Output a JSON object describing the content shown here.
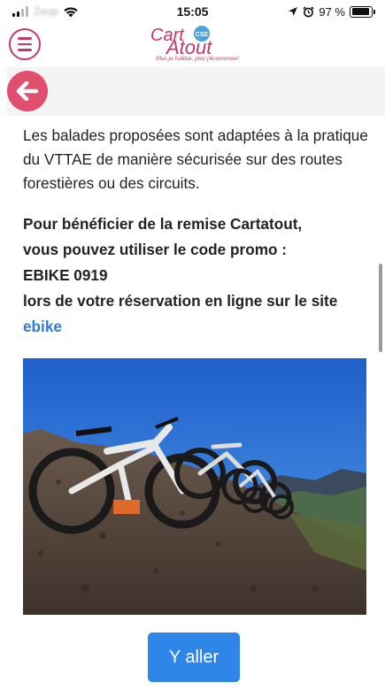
{
  "status_bar": {
    "carrier": "Zeop",
    "time": "15:05",
    "battery": "97 %",
    "battery_level": 0.97
  },
  "header": {
    "menu_icon": "hamburger-menu-icon",
    "logo_cart": "Cart",
    "logo_atout": "Atout",
    "logo_badge": "CSE",
    "logo_tagline": "Plus je l'utilise, plus j'économise!",
    "brand_color": "#c5376d"
  },
  "back": {
    "icon": "arrow-left-icon",
    "color": "#e0506e"
  },
  "content": {
    "intro": "Les balades proposées sont adaptées à la pratique du VTTAE de manière sécurisée sur des routes forestières ou des circuits.",
    "promo_line1": "Pour bénéficier de la remise Cartatout,",
    "promo_line2": "vous pouvez utiliser le code promo :",
    "promo_code": "EBIKE 0919",
    "promo_line3": "lors de votre réservation en ligne sur le site",
    "promo_link": "ebike",
    "link_color": "#2f7bd4"
  },
  "cta": {
    "label": "Y aller",
    "color": "#2e86e8"
  }
}
